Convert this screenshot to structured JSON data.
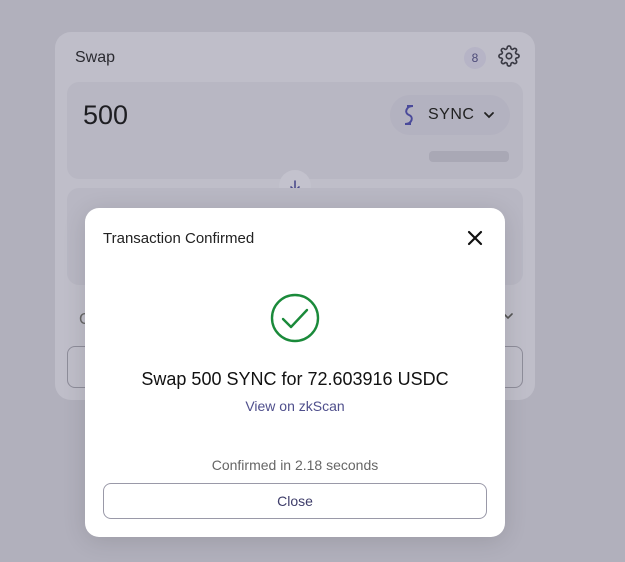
{
  "swap": {
    "title": "Swap",
    "badge": "8",
    "sell_amount": "500",
    "sell_token": "SYNC"
  },
  "modal": {
    "title": "Transaction Confirmed",
    "summary": "Swap 500 SYNC for 72.603916 USDC",
    "link": "View on zkScan",
    "time": "Confirmed in 2.18 seconds",
    "close_label": "Close"
  },
  "colors": {
    "success": "#1a8a3a",
    "link": "#4f4f8c",
    "overlay": "#b1b0bc"
  }
}
